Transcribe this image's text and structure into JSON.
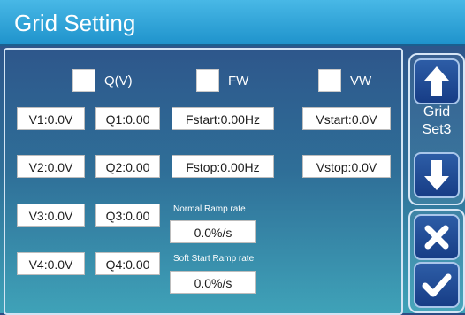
{
  "header": {
    "title": "Grid Setting"
  },
  "checkboxes": [
    {
      "label": "Q(V)"
    },
    {
      "label": "FW"
    },
    {
      "label": "VW"
    }
  ],
  "fields": {
    "v1": "V1:0.0V",
    "q1": "Q1:0.00",
    "fstart": "Fstart:0.00Hz",
    "vstart": "Vstart:0.0V",
    "v2": "V2:0.0V",
    "q2": "Q2:0.00",
    "fstop": "Fstop:0.00Hz",
    "vstop": "Vstop:0.0V",
    "v3": "V3:0.0V",
    "q3": "Q3:0.00",
    "v4": "V4:0.0V",
    "q4": "Q4:0.00"
  },
  "ramp": {
    "normal_label": "Normal Ramp rate",
    "normal_value": "0.0%/s",
    "soft_label": "Soft Start Ramp rate",
    "soft_value": "0.0%/s"
  },
  "side": {
    "grid_set_label": "Grid\nSet3"
  },
  "icons": {
    "up": "arrow-up-icon",
    "down": "arrow-down-icon",
    "cancel": "close-icon",
    "confirm": "check-icon"
  },
  "colors": {
    "title_bar": "#1f93cc",
    "button": "#173d86"
  }
}
